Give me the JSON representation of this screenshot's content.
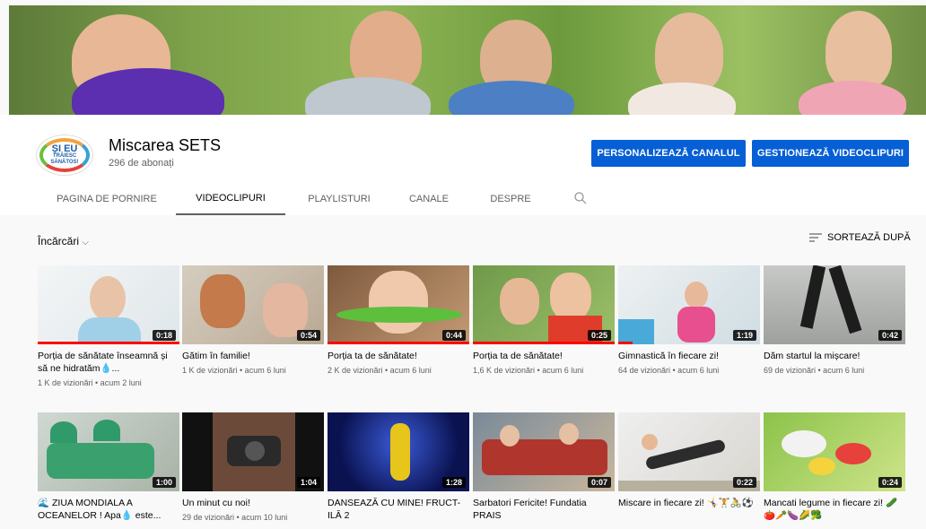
{
  "channel": {
    "name": "Miscarea SETS",
    "subscribers": "296 de abonați",
    "logo_text_1": "ȘI EU",
    "logo_text_2": "TRĂIESC",
    "logo_text_3": "SĂNĂTOS!"
  },
  "actions": {
    "customize": "PERSONALIZEAZĂ CANALUL",
    "manage": "GESTIONEAZĂ VIDEOCLIPURI",
    "accent": "#065fd4"
  },
  "tabs": [
    {
      "label": "PAGINA DE PORNIRE"
    },
    {
      "label": "VIDEOCLIPURI"
    },
    {
      "label": "PLAYLISTURI"
    },
    {
      "label": "CANALE"
    },
    {
      "label": "DESPRE"
    }
  ],
  "filter": {
    "label": "Încărcări"
  },
  "sort": {
    "label": "SORTEAZĂ DUPĂ"
  },
  "videos": [
    {
      "title": "Porția de sănătate înseamnă și să ne hidratăm💧...",
      "meta": "1 K de vizionări • acum 2 luni",
      "duration": "0:18",
      "progress": 1.0
    },
    {
      "title": "Gătim în familie!",
      "meta": "1 K de vizionări • acum 6 luni",
      "duration": "0:54",
      "progress": 0.0
    },
    {
      "title": "Porția ta de sănătate!",
      "meta": "2 K de vizionări • acum 6 luni",
      "duration": "0:44",
      "progress": 1.0
    },
    {
      "title": "Porția ta de sănătate!",
      "meta": "1,6 K de vizionări • acum 6 luni",
      "duration": "0:25",
      "progress": 1.0
    },
    {
      "title": "Gimnastică în fiecare zi!",
      "meta": "64 de vizionări • acum 6 luni",
      "duration": "1:19",
      "progress": 0.1
    },
    {
      "title": "Dăm startul la mișcare!",
      "meta": "69 de vizionări • acum 6 luni",
      "duration": "0:42",
      "progress": 0.0
    },
    {
      "title": "🌊 ZIUA MONDIALA A OCEANELOR ! Apa💧 este...",
      "meta": "",
      "duration": "1:00",
      "progress": 0.0
    },
    {
      "title": "Un minut cu noi!",
      "meta": "29 de vizionări • acum 10 luni",
      "duration": "1:04",
      "progress": 0.0
    },
    {
      "title": "DANSEAZĂ CU MINE! FRUCT-ILĂ 2",
      "meta": "",
      "duration": "1:28",
      "progress": 0.0
    },
    {
      "title": "Sarbatori Fericite! Fundatia PRAIS",
      "meta": "",
      "duration": "0:07",
      "progress": 0.0
    },
    {
      "title": "Miscare in fiecare zi! 🤸‍♀️🏋️🚴⚽",
      "meta": "",
      "duration": "0:22",
      "progress": 0.0
    },
    {
      "title": "Mancati legume in fiecare zi! 🥒🍅🥕🍆🌽🥦",
      "meta": "",
      "duration": "0:24",
      "progress": 0.0
    }
  ],
  "colors": {
    "progress": "#ff0000",
    "duration_bg": "#000000"
  }
}
